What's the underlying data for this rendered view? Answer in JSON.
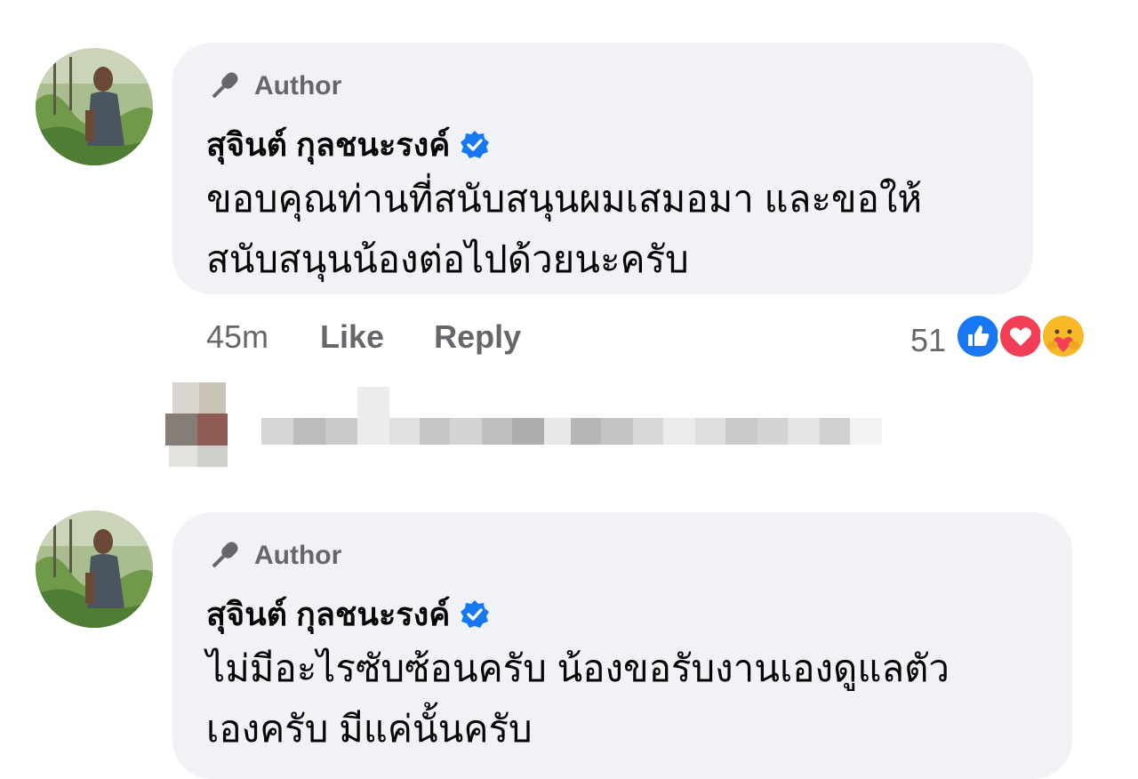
{
  "comments": [
    {
      "badge_label": "Author",
      "badge_icon": "microphone-icon",
      "name": "สุจินต์ กุลชนะรงค์",
      "verified": true,
      "text_lines": [
        "ขอบคุณท่านที่สนับสนุนผมเสมอมา และขอให้",
        "สนับสนุนน้องต่อไปด้วยนะครับ"
      ],
      "time": "45m",
      "like_label": "Like",
      "reply_label": "Reply",
      "reaction_count": "51",
      "reactions": [
        "like-reaction-icon",
        "love-reaction-icon",
        "care-reaction-icon"
      ]
    },
    {
      "badge_label": "Author",
      "badge_icon": "microphone-icon",
      "name": "สุจินต์ กุลชนะรงค์",
      "verified": true,
      "text_lines": [
        "ไม่มีอะไรซับซ้อนครับ น้องขอรับงานเองดูแลตัว",
        "เองครับ มีแค่นั้นครับ"
      ]
    }
  ],
  "colors": {
    "bubble_bg": "#f0f2f5",
    "secondary_text": "#65676b",
    "verified_blue": "#1877f2",
    "like_blue": "#1877f2",
    "love_red": "#f33e58"
  }
}
